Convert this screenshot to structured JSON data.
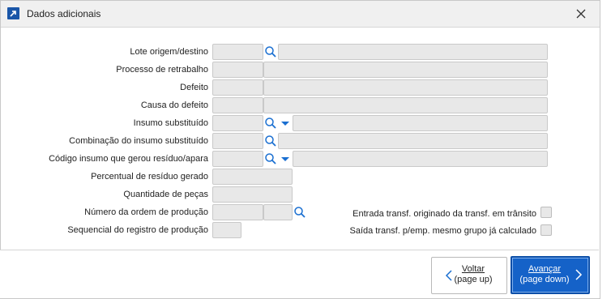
{
  "window": {
    "title": "Dados adicionais"
  },
  "fields": {
    "lote_label": "Lote origem/destino",
    "processo_label": "Processo de retrabalho",
    "defeito_label": "Defeito",
    "causa_label": "Causa do defeito",
    "insumo_label": "Insumo substituído",
    "combinacao_label": "Combinação do insumo substituído",
    "codigo_residuo_label": "Código insumo que gerou resíduo/apara",
    "percentual_label": "Percentual de resíduo gerado",
    "quantidade_label": "Quantidade de peças",
    "numero_ordem_label": "Número da ordem de produção",
    "sequencial_label": "Sequencial do registro de produção"
  },
  "checks": {
    "entrada_label": "Entrada transf. originado da transf. em trânsito",
    "saida_label": "Saída transf.  p/emp. mesmo grupo já calculado",
    "entrada_checked": false,
    "saida_checked": false
  },
  "buttons": {
    "back_line1": "Voltar",
    "back_line2": "(page up)",
    "next_line1": "Avançar",
    "next_line2": "(page down)"
  },
  "colors": {
    "accent": "#1562c8",
    "field_bg": "#e8e8e8",
    "icon_blue": "#1a6fd1"
  },
  "icons": {
    "app": "share-arrow-icon",
    "close": "close-icon",
    "search": "search-icon",
    "dropdown": "caret-down-icon",
    "back": "chevron-left-icon",
    "next": "chevron-right-icon"
  }
}
